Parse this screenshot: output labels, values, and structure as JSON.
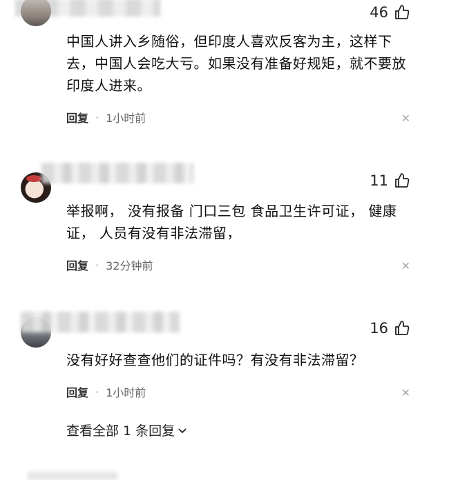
{
  "comments": [
    {
      "likes": "46",
      "text": "中国人讲入乡随俗，但印度人喜欢反客为主，这样下去，中国人会吃大亏。如果没有准备好规矩，就不要放印度人进来。",
      "reply_label": "回复",
      "time": "1小时前"
    },
    {
      "likes": "11",
      "text": "举报啊， 没有报备 门口三包 食品卫生许可证， 健康证， 人员有没有非法滞留，",
      "reply_label": "回复",
      "time": "32分钟前"
    },
    {
      "likes": "16",
      "text": "没有好好查查他们的证件吗？有没有非法滞留？",
      "reply_label": "回复",
      "time": "1小时前"
    }
  ],
  "view_all": "查看全部 1 条回复",
  "icons": {
    "like": "thumb-up-icon",
    "close": "close-icon",
    "expand": "chevron-down-icon"
  }
}
